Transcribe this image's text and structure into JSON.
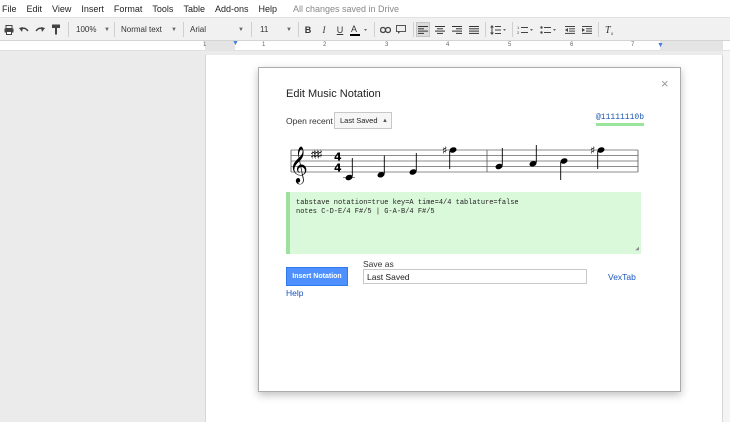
{
  "menu": {
    "items": [
      "File",
      "Edit",
      "View",
      "Insert",
      "Format",
      "Tools",
      "Table",
      "Add-ons",
      "Help"
    ],
    "status": "All changes saved in Drive"
  },
  "toolbar": {
    "zoom": "100%",
    "style": "Normal text",
    "font": "Arial",
    "size": "11"
  },
  "ruler": {
    "numbers": [
      "1",
      "1",
      "2",
      "3",
      "4",
      "5",
      "6",
      "7"
    ]
  },
  "dialog": {
    "title": "Edit Music Notation",
    "open_recent_label": "Open recent",
    "open_recent_value": "Last Saved",
    "version": "@11111110b",
    "code_line1": "tabstave notation=true key=A time=4/4 tablature=false",
    "code_line2": "notes C-D-E/4 F#/5 | G-A-B/4 F#/5",
    "insert_label": "Insert Notation",
    "help_label": "Help",
    "save_as_label": "Save as",
    "save_as_value": "Last Saved",
    "vextab_label": "VexTab"
  },
  "notation": {
    "clef": "𝄞",
    "key_signature": "♯♯♯",
    "time_signature": [
      "4",
      "4"
    ],
    "notes": [
      {
        "pitch": "C4",
        "accidental": ""
      },
      {
        "pitch": "D4",
        "accidental": ""
      },
      {
        "pitch": "E4",
        "accidental": ""
      },
      {
        "pitch": "F#5",
        "accidental": "♯"
      },
      {
        "pitch": "G4",
        "accidental": ""
      },
      {
        "pitch": "A4",
        "accidental": ""
      },
      {
        "pitch": "B4",
        "accidental": ""
      },
      {
        "pitch": "F#5",
        "accidental": "♯"
      }
    ]
  },
  "colors": {
    "accent": "#4d90fe",
    "editor_bg": "#daf8da",
    "editor_border": "#9ee09e",
    "link": "#1a55c0"
  }
}
